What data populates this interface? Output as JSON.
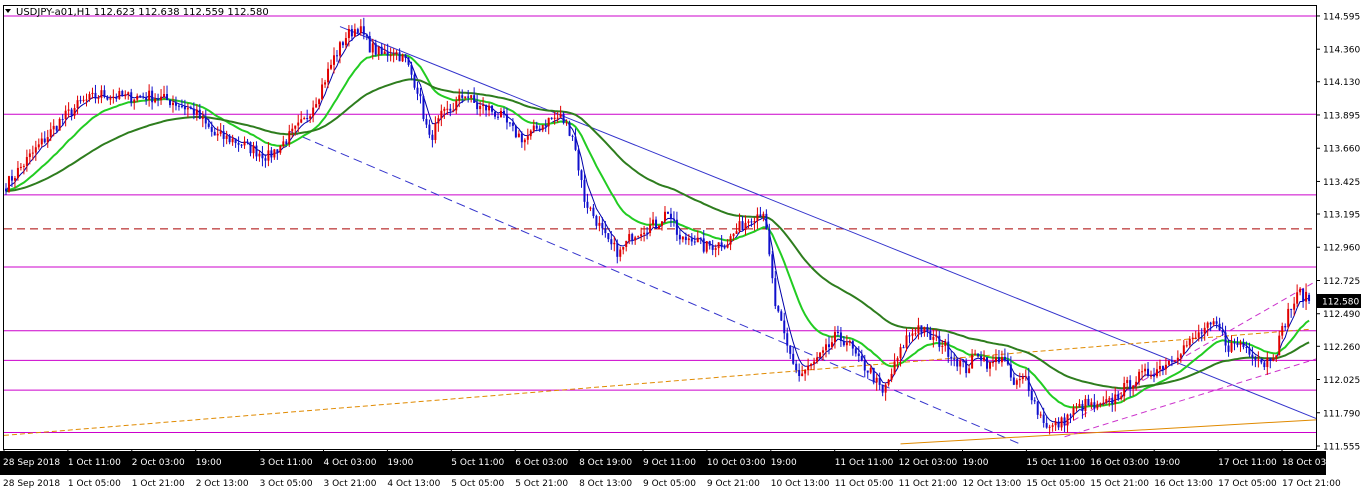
{
  "window": {
    "symbol_info": "USDJPY-a01,H1  112.623 112.638 112.559 112.580",
    "menu_icon": "triangle-down-icon"
  },
  "colors": {
    "background": "#ffffff",
    "bull": "#e00000",
    "bear": "#1010cc",
    "ma_fast": "#0000aa",
    "ma_mid": "#22cc22",
    "ma_slow": "#2e7d1e",
    "level_line": "#cc00cc",
    "dashed_level": "#aa0000",
    "trend_line": "#3333cc",
    "orange_trend": "#e08a00",
    "price_box": "#000000"
  },
  "chart_data": {
    "type": "candlestick",
    "timeframe": "H1",
    "symbol": "USDJPY-a01",
    "ohlc_current": {
      "open": 112.623,
      "high": 112.638,
      "low": 112.559,
      "close": 112.58
    },
    "ylim": [
      111.555,
      114.63
    ],
    "y_ticks": [
      "114.595",
      "114.360",
      "114.130",
      "113.895",
      "113.660",
      "113.425",
      "113.195",
      "112.960",
      "112.725",
      "112.490",
      "112.260",
      "112.025",
      "111.790",
      "111.555"
    ],
    "current_price_label": "112.580",
    "x_ticks_top": [
      "28 Sep 2018",
      "1 Oct 11:00",
      "2 Oct 03:00",
      "19:00",
      "3 Oct 11:00",
      "4 Oct 03:00",
      "19:00",
      "5 Oct 11:00",
      "6 Oct 03:00",
      "8 Oct 19:00",
      "9 Oct 11:00",
      "10 Oct 03:00",
      "19:00",
      "11 Oct 11:00",
      "12 Oct 03:00",
      "19:00",
      "15 Oct 11:00",
      "16 Oct 03:00",
      "19:00",
      "17 Oct 11:00",
      "18 Oct 03:00"
    ],
    "x_ticks_bottom": [
      "28 Sep 2018",
      "1 Oct 05:00",
      "1 Oct 21:00",
      "2 Oct 13:00",
      "3 Oct 05:00",
      "3 Oct 21:00",
      "4 Oct 13:00",
      "5 Oct 05:00",
      "5 Oct 21:00",
      "8 Oct 13:00",
      "9 Oct 05:00",
      "9 Oct 21:00",
      "10 Oct 13:00",
      "11 Oct 05:00",
      "11 Oct 21:00",
      "12 Oct 13:00",
      "15 Oct 05:00",
      "15 Oct 21:00",
      "16 Oct 13:00",
      "17 Oct 05:00",
      "17 Oct 21:00"
    ],
    "horizontal_levels": [
      114.595,
      113.9,
      113.33,
      113.09,
      112.82,
      112.37,
      112.16,
      111.95,
      111.65
    ],
    "dashed_level": 113.09,
    "close_anchors": [
      [
        0,
        113.4
      ],
      [
        6,
        113.55
      ],
      [
        12,
        113.7
      ],
      [
        18,
        113.85
      ],
      [
        25,
        113.98
      ],
      [
        32,
        114.04
      ],
      [
        40,
        114.02
      ],
      [
        48,
        114.03
      ],
      [
        56,
        113.99
      ],
      [
        63,
        113.92
      ],
      [
        70,
        113.75
      ],
      [
        76,
        113.72
      ],
      [
        82,
        113.66
      ],
      [
        88,
        113.6
      ],
      [
        94,
        113.72
      ],
      [
        100,
        113.85
      ],
      [
        105,
        114.05
      ],
      [
        110,
        114.3
      ],
      [
        114,
        114.45
      ],
      [
        118,
        114.52
      ],
      [
        122,
        114.38
      ],
      [
        126,
        114.32
      ],
      [
        130,
        114.35
      ],
      [
        134,
        114.28
      ],
      [
        138,
        114.08
      ],
      [
        142,
        113.72
      ],
      [
        146,
        113.88
      ],
      [
        150,
        113.95
      ],
      [
        154,
        114.05
      ],
      [
        158,
        113.95
      ],
      [
        162,
        113.94
      ],
      [
        166,
        113.88
      ],
      [
        170,
        113.78
      ],
      [
        174,
        113.72
      ],
      [
        178,
        113.8
      ],
      [
        182,
        113.86
      ],
      [
        186,
        113.88
      ],
      [
        190,
        113.76
      ],
      [
        194,
        113.3
      ],
      [
        198,
        113.15
      ],
      [
        202,
        112.98
      ],
      [
        206,
        112.92
      ],
      [
        210,
        113.05
      ],
      [
        214,
        113.1
      ],
      [
        218,
        113.12
      ],
      [
        222,
        113.22
      ],
      [
        226,
        113.0
      ],
      [
        230,
        113.04
      ],
      [
        234,
        112.96
      ],
      [
        238,
        112.98
      ],
      [
        242,
        113.0
      ],
      [
        246,
        113.1
      ],
      [
        250,
        113.18
      ],
      [
        254,
        113.22
      ],
      [
        258,
        112.55
      ],
      [
        262,
        112.25
      ],
      [
        266,
        112.05
      ],
      [
        270,
        112.12
      ],
      [
        274,
        112.2
      ],
      [
        278,
        112.32
      ],
      [
        282,
        112.3
      ],
      [
        286,
        112.15
      ],
      [
        290,
        112.08
      ],
      [
        294,
        111.92
      ],
      [
        298,
        112.12
      ],
      [
        302,
        112.32
      ],
      [
        306,
        112.4
      ],
      [
        310,
        112.32
      ],
      [
        314,
        112.28
      ],
      [
        318,
        112.18
      ],
      [
        322,
        112.1
      ],
      [
        326,
        112.22
      ],
      [
        330,
        112.12
      ],
      [
        334,
        112.2
      ],
      [
        338,
        111.98
      ],
      [
        342,
        112.04
      ],
      [
        346,
        111.8
      ],
      [
        350,
        111.68
      ],
      [
        354,
        111.72
      ],
      [
        358,
        111.8
      ],
      [
        362,
        111.85
      ],
      [
        366,
        111.82
      ],
      [
        370,
        111.86
      ],
      [
        374,
        111.94
      ],
      [
        378,
        112.02
      ],
      [
        382,
        112.06
      ],
      [
        386,
        112.1
      ],
      [
        390,
        112.16
      ],
      [
        394,
        112.24
      ],
      [
        398,
        112.3
      ],
      [
        402,
        112.38
      ],
      [
        406,
        112.4
      ],
      [
        410,
        112.26
      ],
      [
        414,
        112.28
      ],
      [
        418,
        112.22
      ],
      [
        422,
        112.14
      ],
      [
        426,
        112.24
      ],
      [
        430,
        112.5
      ],
      [
        434,
        112.64
      ],
      [
        437,
        112.58
      ]
    ]
  }
}
